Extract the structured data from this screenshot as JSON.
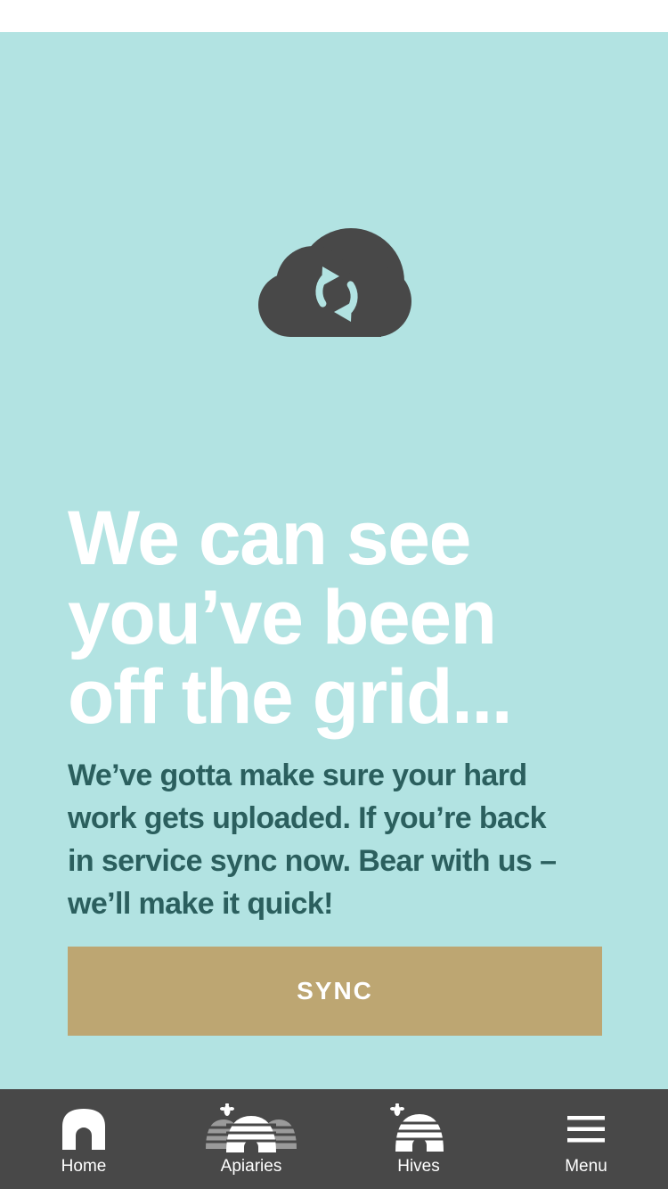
{
  "offline_screen": {
    "illustration": "cloud-sync-icon",
    "headline_lines": [
      "We can see",
      "you’ve been",
      "off the grid..."
    ],
    "body_lines": [
      "We’ve gotta make sure your hard",
      "work gets uploaded. If you’re back",
      "in service sync now. Bear with us –",
      "we’ll make it quick!"
    ],
    "sync_label": "SYNC"
  },
  "tab_bar": {
    "items": [
      {
        "label": "Home",
        "icon": "home-icon"
      },
      {
        "label": "Apiaries",
        "icon": "apiaries-icon"
      },
      {
        "label": "Hives",
        "icon": "hive-icon"
      },
      {
        "label": "Menu",
        "icon": "menu-icon"
      }
    ]
  },
  "colors": {
    "background": "#b2e3e2",
    "headline": "#ffffff",
    "body_text": "#2b5f5e",
    "sync_button": "#bda672",
    "tab_bar": "#484848",
    "cloud": "#484848"
  }
}
